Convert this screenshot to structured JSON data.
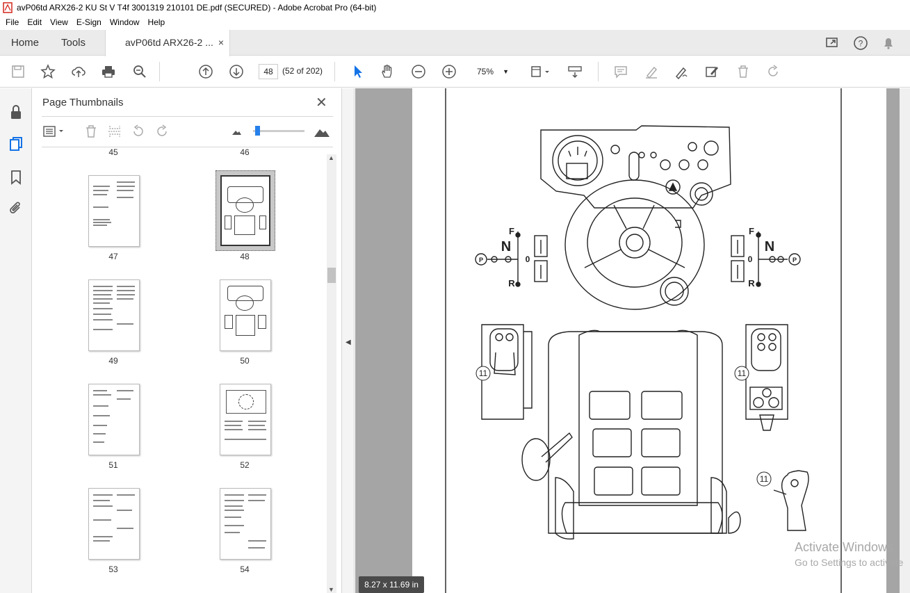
{
  "window": {
    "title": "avP06td ARX26-2 KU St V T4f 3001319 210101 DE.pdf (SECURED) - Adobe Acrobat Pro (64-bit)"
  },
  "menu": [
    "File",
    "Edit",
    "View",
    "E-Sign",
    "Window",
    "Help"
  ],
  "tabs": {
    "home": "Home",
    "tools": "Tools",
    "document": "avP06td ARX26-2 ...",
    "close": "×"
  },
  "toolbar": {
    "page_number": "48",
    "page_of": "(52 of 202)",
    "zoom": "75%"
  },
  "panel": {
    "title": "Page Thumbnails",
    "close": "✕",
    "thumbnails": [
      {
        "label": "45"
      },
      {
        "label": "46"
      },
      {
        "label": "47"
      },
      {
        "label": "48",
        "selected": true
      },
      {
        "label": "49"
      },
      {
        "label": "50"
      },
      {
        "label": "51"
      },
      {
        "label": "52"
      },
      {
        "label": "53"
      },
      {
        "label": "54"
      }
    ]
  },
  "document": {
    "callouts": [
      "11",
      "11",
      "11"
    ],
    "shift_labels": {
      "forward": "F",
      "neutral": "N",
      "zero": "0",
      "reverse": "R",
      "park": "P"
    }
  },
  "status": {
    "page_size": "8.27 x 11.69 in"
  },
  "watermark": {
    "line1": "Activate Windows",
    "line2": "Go to Settings to activate"
  }
}
